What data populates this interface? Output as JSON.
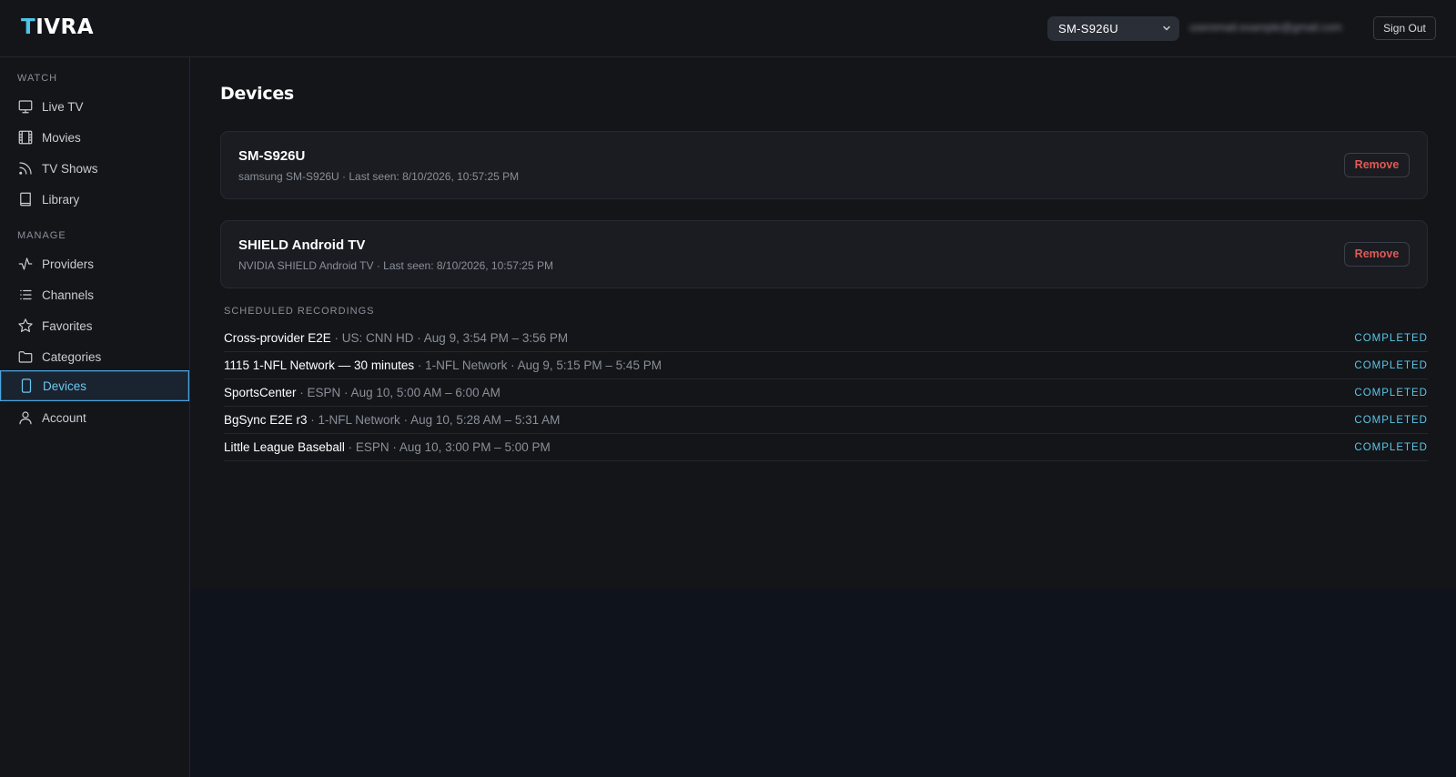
{
  "app": {
    "logo_first": "T",
    "logo_rest": "IVRA",
    "accent": "#4fc3e8"
  },
  "header": {
    "device_select": "SM-S926U",
    "email": "useremail.example@gmail.com",
    "sign_out": "Sign Out"
  },
  "sidebar": {
    "watch_label": "WATCH",
    "manage_label": "MANAGE",
    "items": [
      {
        "label": "Live TV",
        "icon": "tv-icon"
      },
      {
        "label": "Movies",
        "icon": "film-icon"
      },
      {
        "label": "TV Shows",
        "icon": "rss-icon"
      },
      {
        "label": "Library",
        "icon": "book-icon"
      },
      {
        "label": "Providers",
        "icon": "activity-icon"
      },
      {
        "label": "Channels",
        "icon": "list-icon"
      },
      {
        "label": "Favorites",
        "icon": "star-icon"
      },
      {
        "label": "Categories",
        "icon": "folder-icon"
      },
      {
        "label": "Devices",
        "icon": "smartphone-icon"
      },
      {
        "label": "Account",
        "icon": "user-icon"
      }
    ],
    "active": "Devices"
  },
  "main": {
    "title": "Devices",
    "devices": [
      {
        "name": "SM-S926U",
        "meta": "samsung SM-S926U · Last seen: 8/10/2026, 10:57:25 PM",
        "remove": "Remove"
      },
      {
        "name": "SHIELD Android TV",
        "meta": "NVIDIA SHIELD Android TV · Last seen: 8/10/2026, 10:57:25 PM",
        "remove": "Remove"
      }
    ],
    "recordings_label": "SCHEDULED RECORDINGS",
    "recordings": [
      {
        "title": "Cross-provider E2E",
        "meta": " · US: CNN HD · Aug 9, 3:54 PM – 3:56 PM",
        "status": "COMPLETED"
      },
      {
        "title": "1115 1-NFL Network — 30 minutes",
        "meta": " · 1-NFL Network · Aug 9, 5:15 PM – 5:45 PM",
        "status": "COMPLETED"
      },
      {
        "title": "SportsCenter",
        "meta": " · ESPN · Aug 10, 5:00 AM – 6:00 AM",
        "status": "COMPLETED"
      },
      {
        "title": "BgSync E2E r3",
        "meta": " · 1-NFL Network · Aug 10, 5:28 AM – 5:31 AM",
        "status": "COMPLETED"
      },
      {
        "title": "Little League Baseball",
        "meta": " · ESPN · Aug 10, 3:00 PM – 5:00 PM",
        "status": "COMPLETED"
      }
    ]
  }
}
